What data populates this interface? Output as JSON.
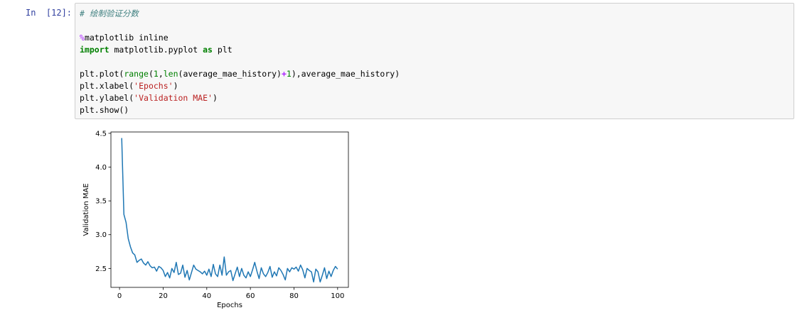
{
  "cell": {
    "prompt": "In  [12]:",
    "code": {
      "comment": "# 绘制验证分数",
      "magic_symbol": "%",
      "magic_rest": "matplotlib inline",
      "import_kw": "import",
      "import_module": " matplotlib.pyplot ",
      "as_kw": "as",
      "import_alias": " plt",
      "plot_prefix": "plt.plot(",
      "range_fn": "range",
      "plot_paren1": "(",
      "num_one_a": "1",
      "plot_comma1": ",",
      "len_fn": "len",
      "plot_arg": "(average_mae_history)",
      "plus_op": "+",
      "num_one_b": "1",
      "plot_suffix": "),average_mae_history)",
      "xlabel_prefix": "plt.xlabel(",
      "xlabel_str": "'Epochs'",
      "xlabel_suffix": ")",
      "ylabel_prefix": "plt.ylabel(",
      "ylabel_str": "'Validation MAE'",
      "ylabel_suffix": ")",
      "show_line": "plt.show()"
    }
  },
  "chart_data": {
    "type": "line",
    "title": "",
    "xlabel": "Epochs",
    "ylabel": "Validation MAE",
    "xlim": [
      -3.95,
      104.95
    ],
    "ylim": [
      2.22,
      4.52
    ],
    "xticks": [
      0,
      20,
      40,
      60,
      80,
      100
    ],
    "xtick_labels": [
      "0",
      "20",
      "40",
      "60",
      "80",
      "100"
    ],
    "yticks": [
      2.5,
      3.0,
      3.5,
      4.0,
      4.5
    ],
    "ytick_labels": [
      "2.5",
      "3.0",
      "3.5",
      "4.0",
      "4.5"
    ],
    "grid": false,
    "line_color": "#1f77b4",
    "x_start": 1,
    "x_step": 1,
    "values": [
      4.43,
      3.3,
      3.18,
      2.94,
      2.82,
      2.73,
      2.7,
      2.59,
      2.62,
      2.64,
      2.58,
      2.55,
      2.6,
      2.54,
      2.51,
      2.52,
      2.46,
      2.53,
      2.51,
      2.47,
      2.38,
      2.44,
      2.36,
      2.5,
      2.44,
      2.59,
      2.41,
      2.43,
      2.55,
      2.37,
      2.47,
      2.33,
      2.44,
      2.55,
      2.49,
      2.47,
      2.45,
      2.42,
      2.46,
      2.4,
      2.49,
      2.38,
      2.56,
      2.42,
      2.38,
      2.55,
      2.4,
      2.67,
      2.4,
      2.45,
      2.47,
      2.32,
      2.42,
      2.52,
      2.38,
      2.5,
      2.4,
      2.36,
      2.45,
      2.38,
      2.48,
      2.59,
      2.46,
      2.35,
      2.51,
      2.42,
      2.38,
      2.44,
      2.53,
      2.37,
      2.45,
      2.39,
      2.51,
      2.47,
      2.41,
      2.33,
      2.5,
      2.45,
      2.51,
      2.49,
      2.52,
      2.46,
      2.55,
      2.48,
      2.36,
      2.5,
      2.47,
      2.45,
      2.3,
      2.49,
      2.45,
      2.3,
      2.4,
      2.51,
      2.35,
      2.46,
      2.38,
      2.47,
      2.53,
      2.49
    ]
  }
}
